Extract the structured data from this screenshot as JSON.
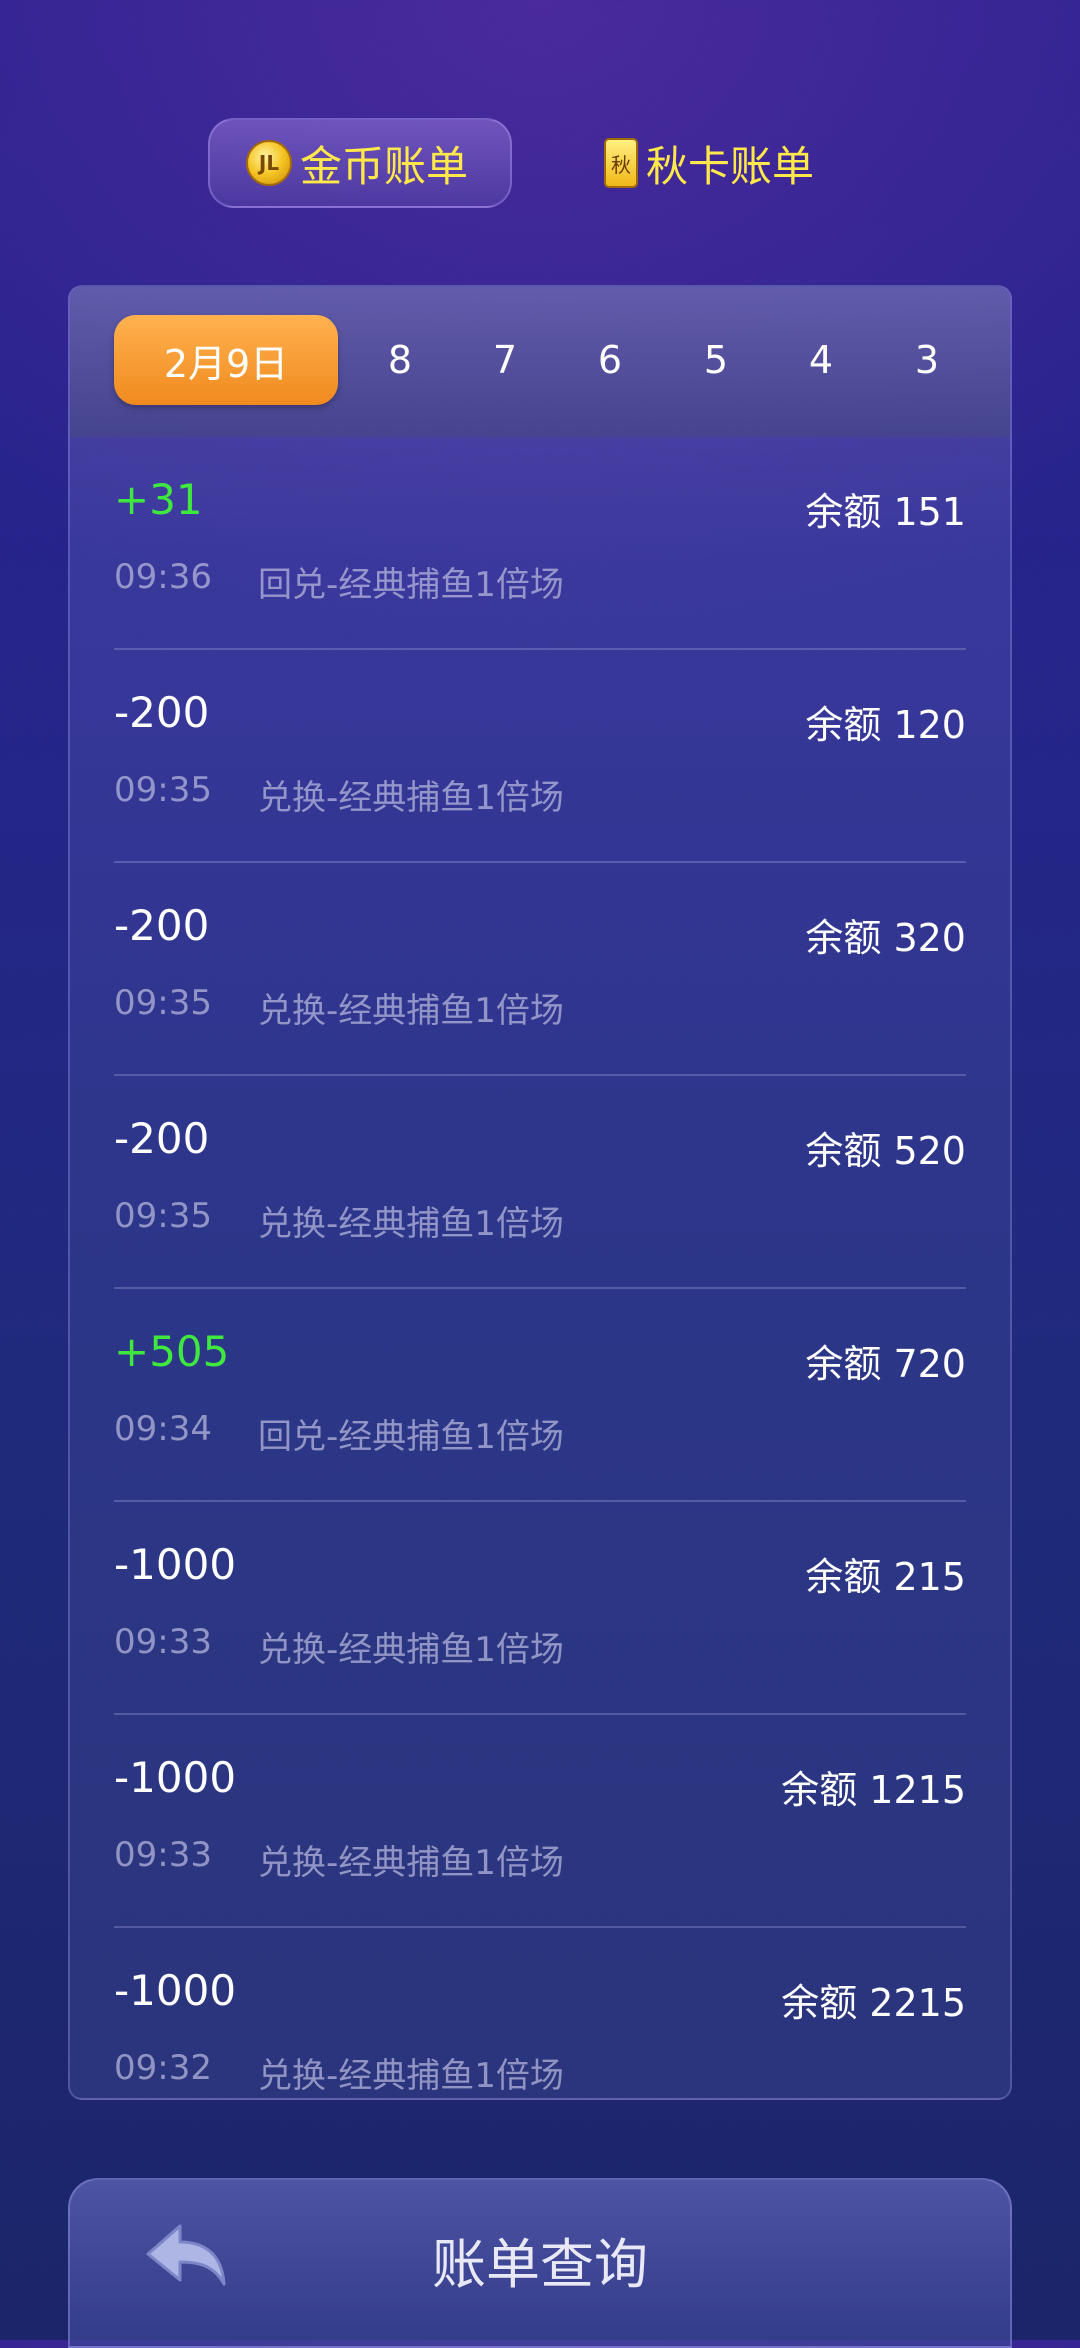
{
  "tabs": {
    "gold": {
      "label": "金币账单",
      "icon": "coin-icon",
      "icon_text": "JL"
    },
    "card": {
      "label": "秋卡账单",
      "icon": "card-icon",
      "icon_text": "秋"
    }
  },
  "dates": {
    "active": "2月9日",
    "others": [
      "8",
      "7",
      "6",
      "5",
      "4",
      "3"
    ]
  },
  "records": [
    {
      "amount": "+31",
      "balance": "余额 151",
      "time": "09:36",
      "desc": "回兑-经典捕鱼1倍场",
      "positive": true
    },
    {
      "amount": "-200",
      "balance": "余额 120",
      "time": "09:35",
      "desc": "兑换-经典捕鱼1倍场",
      "positive": false
    },
    {
      "amount": "-200",
      "balance": "余额 320",
      "time": "09:35",
      "desc": "兑换-经典捕鱼1倍场",
      "positive": false
    },
    {
      "amount": "-200",
      "balance": "余额 520",
      "time": "09:35",
      "desc": "兑换-经典捕鱼1倍场",
      "positive": false
    },
    {
      "amount": "+505",
      "balance": "余额 720",
      "time": "09:34",
      "desc": "回兑-经典捕鱼1倍场",
      "positive": true
    },
    {
      "amount": "-1000",
      "balance": "余额 215",
      "time": "09:33",
      "desc": "兑换-经典捕鱼1倍场",
      "positive": false
    },
    {
      "amount": "-1000",
      "balance": "余额 1215",
      "time": "09:33",
      "desc": "兑换-经典捕鱼1倍场",
      "positive": false
    },
    {
      "amount": "-1000",
      "balance": "余额 2215",
      "time": "09:32",
      "desc": "兑换-经典捕鱼1倍场",
      "positive": false
    }
  ],
  "footer": {
    "title": "账单查询",
    "back_icon": "back-arrow-icon"
  },
  "colors": {
    "positive": "#3fe83f",
    "active_date": "#f5962f",
    "tab_text": "#ffe84a"
  }
}
